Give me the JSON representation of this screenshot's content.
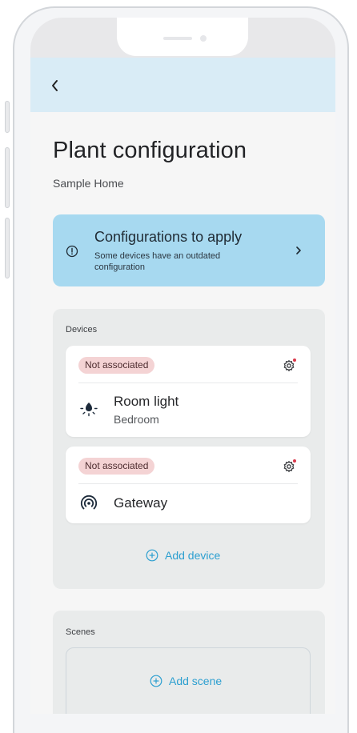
{
  "header": {
    "back_icon": "chevron-left-icon"
  },
  "page": {
    "title": "Plant configuration",
    "subtitle": "Sample Home"
  },
  "config_banner": {
    "icon": "info-circle-icon",
    "title": "Configurations to apply",
    "text": "Some devices have an outdated configuration",
    "chevron_icon": "chevron-right-icon",
    "background": "#a7d9f0"
  },
  "devices": {
    "label": "Devices",
    "items": [
      {
        "status": "Not associated",
        "name": "Room light",
        "room": "Bedroom",
        "icon": "light-bulb-icon",
        "settings_icon": "gear-icon"
      },
      {
        "status": "Not associated",
        "name": "Gateway",
        "room": "",
        "icon": "gateway-signal-icon",
        "settings_icon": "gear-icon"
      }
    ],
    "add_label": "Add device"
  },
  "scenes": {
    "label": "Scenes",
    "add_label": "Add scene"
  },
  "colors": {
    "accent": "#2c9fd0",
    "header_bg": "#d9ecf6",
    "badge_bg": "#f4d3d4",
    "notification_dot": "#d9394b"
  }
}
